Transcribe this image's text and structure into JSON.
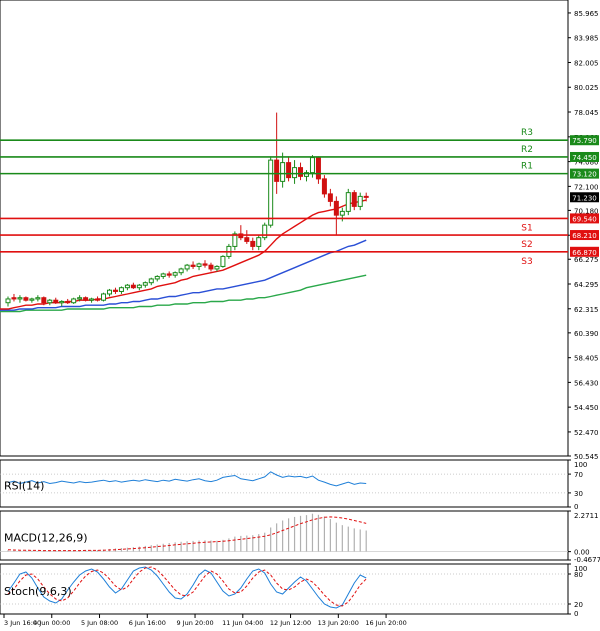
{
  "chart_data": {
    "type": "candlestick",
    "price_axis": {
      "min": 50.545,
      "max": 87.0,
      "ticks": [
        "85.965",
        "83.985",
        "82.005",
        "80.025",
        "78.045",
        "76.060",
        "74.080",
        "72.100",
        "70.180",
        "68.195",
        "66.275",
        "64.295",
        "62.315",
        "60.390",
        "58.405",
        "56.430",
        "54.450",
        "52.470",
        "50.545"
      ]
    },
    "x_ticks": [
      {
        "label": "3 Jun 16:00",
        "i": 0
      },
      {
        "label": "4 Jun 00:00",
        "i": 8
      },
      {
        "label": "5 Jun 08:00",
        "i": 16
      },
      {
        "label": "6 Jun 16:00",
        "i": 24
      },
      {
        "label": "9 Jun 20:00",
        "i": 32
      },
      {
        "label": "11 Jun 04:00",
        "i": 40
      },
      {
        "label": "12 Jun 12:00",
        "i": 48
      },
      {
        "label": "13 Jun 20:00",
        "i": 56
      },
      {
        "label": "16 Jun 20:00",
        "i": 64
      }
    ],
    "levels": [
      {
        "name": "R3",
        "value": 75.79,
        "label": "75.790",
        "color": "#1a8a1a"
      },
      {
        "name": "R2",
        "value": 74.45,
        "label": "74.450",
        "color": "#1a8a1a"
      },
      {
        "name": "R1",
        "value": 73.12,
        "label": "73.120",
        "color": "#1a8a1a"
      },
      {
        "name": "S1",
        "value": 69.54,
        "label": "69.540",
        "color": "#e01010"
      },
      {
        "name": "S2",
        "value": 68.21,
        "label": "68.210",
        "color": "#e01010"
      },
      {
        "name": "S3",
        "value": 66.87,
        "label": "66.870",
        "color": "#e01010"
      }
    ],
    "last_price": {
      "value": 71.23,
      "label": "71.230"
    },
    "candles": [
      [
        62.8,
        63.3,
        62.5,
        63.1
      ],
      [
        63.2,
        63.5,
        62.9,
        63.1
      ],
      [
        63.1,
        63.4,
        62.8,
        63.2
      ],
      [
        63.2,
        63.3,
        62.9,
        63.0
      ],
      [
        63.0,
        63.2,
        62.8,
        63.1
      ],
      [
        63.1,
        63.4,
        62.9,
        63.2
      ],
      [
        63.2,
        63.3,
        62.6,
        62.8
      ],
      [
        62.8,
        63.1,
        62.6,
        63.0
      ],
      [
        63.0,
        63.2,
        62.7,
        62.8
      ],
      [
        62.8,
        63.0,
        62.5,
        62.9
      ],
      [
        62.9,
        63.1,
        62.7,
        62.8
      ],
      [
        62.8,
        63.2,
        62.7,
        63.1
      ],
      [
        63.1,
        63.4,
        62.9,
        63.2
      ],
      [
        63.2,
        63.3,
        62.9,
        63.0
      ],
      [
        63.0,
        63.2,
        62.8,
        63.1
      ],
      [
        63.1,
        63.3,
        62.9,
        63.0
      ],
      [
        63.0,
        63.6,
        62.9,
        63.5
      ],
      [
        63.5,
        63.9,
        63.3,
        63.8
      ],
      [
        63.8,
        64.0,
        63.5,
        63.7
      ],
      [
        63.7,
        64.1,
        63.5,
        64.0
      ],
      [
        64.0,
        64.3,
        63.8,
        64.2
      ],
      [
        64.2,
        64.4,
        63.9,
        64.0
      ],
      [
        64.0,
        64.3,
        63.8,
        64.2
      ],
      [
        64.2,
        64.5,
        64.0,
        64.4
      ],
      [
        64.4,
        64.8,
        64.2,
        64.7
      ],
      [
        64.7,
        65.0,
        64.5,
        64.9
      ],
      [
        64.9,
        65.2,
        64.7,
        65.1
      ],
      [
        65.1,
        65.3,
        64.8,
        65.0
      ],
      [
        65.0,
        65.3,
        64.8,
        65.2
      ],
      [
        65.2,
        65.6,
        65.0,
        65.5
      ],
      [
        65.5,
        65.9,
        65.3,
        65.8
      ],
      [
        65.8,
        66.1,
        65.5,
        65.7
      ],
      [
        65.7,
        66.0,
        65.4,
        65.9
      ],
      [
        65.9,
        66.2,
        65.6,
        65.8
      ],
      [
        65.8,
        66.0,
        65.3,
        65.5
      ],
      [
        65.5,
        65.8,
        65.3,
        65.7
      ],
      [
        65.7,
        66.6,
        65.6,
        66.5
      ],
      [
        66.5,
        67.5,
        66.3,
        67.3
      ],
      [
        67.3,
        68.5,
        67.0,
        68.3
      ],
      [
        68.3,
        69.0,
        67.8,
        68.0
      ],
      [
        68.0,
        68.6,
        67.5,
        67.7
      ],
      [
        67.7,
        68.0,
        67.0,
        67.3
      ],
      [
        67.3,
        68.2,
        67.0,
        68.0
      ],
      [
        68.0,
        69.2,
        67.8,
        69.0
      ],
      [
        69.0,
        74.5,
        68.8,
        74.2
      ],
      [
        74.2,
        78.0,
        71.5,
        72.5
      ],
      [
        72.5,
        74.8,
        72.0,
        74.0
      ],
      [
        74.0,
        74.5,
        72.5,
        72.8
      ],
      [
        72.8,
        74.2,
        72.3,
        73.6
      ],
      [
        73.6,
        74.0,
        72.6,
        72.9
      ],
      [
        72.9,
        73.4,
        72.5,
        73.2
      ],
      [
        73.2,
        74.6,
        72.8,
        74.4
      ],
      [
        74.4,
        74.5,
        72.3,
        72.7
      ],
      [
        72.7,
        73.0,
        71.2,
        71.5
      ],
      [
        71.5,
        71.9,
        70.5,
        70.9
      ],
      [
        70.9,
        71.3,
        68.2,
        69.8
      ],
      [
        69.8,
        70.4,
        69.3,
        70.1
      ],
      [
        70.1,
        71.9,
        69.8,
        71.6
      ],
      [
        71.6,
        71.8,
        70.2,
        70.5
      ],
      [
        70.5,
        71.6,
        70.2,
        71.3
      ],
      [
        71.3,
        71.6,
        70.9,
        71.23
      ]
    ],
    "ma_red": [
      62.3,
      62.4,
      62.5,
      62.6,
      62.6,
      62.7,
      62.7,
      62.8,
      62.8,
      62.8,
      62.9,
      62.9,
      63.0,
      63.0,
      63.0,
      63.1,
      63.1,
      63.2,
      63.3,
      63.4,
      63.5,
      63.6,
      63.7,
      63.8,
      63.9,
      64.1,
      64.2,
      64.3,
      64.4,
      64.6,
      64.7,
      64.9,
      65.0,
      65.1,
      65.2,
      65.3,
      65.4,
      65.6,
      65.8,
      66.0,
      66.2,
      66.4,
      66.6,
      66.9,
      67.4,
      67.9,
      68.3,
      68.6,
      68.9,
      69.2,
      69.5,
      69.8,
      70.0,
      70.1,
      70.2,
      70.3,
      70.5,
      70.7,
      70.8,
      70.9,
      71.0
    ],
    "ma_blue": [
      62.2,
      62.2,
      62.3,
      62.3,
      62.3,
      62.4,
      62.4,
      62.4,
      62.4,
      62.5,
      62.5,
      62.5,
      62.5,
      62.6,
      62.6,
      62.6,
      62.6,
      62.7,
      62.7,
      62.8,
      62.8,
      62.9,
      62.9,
      63.0,
      63.1,
      63.1,
      63.2,
      63.3,
      63.3,
      63.4,
      63.5,
      63.6,
      63.6,
      63.7,
      63.8,
      63.9,
      63.9,
      64.0,
      64.1,
      64.2,
      64.3,
      64.4,
      64.5,
      64.6,
      64.8,
      65.0,
      65.2,
      65.4,
      65.6,
      65.8,
      66.0,
      66.2,
      66.4,
      66.6,
      66.8,
      66.9,
      67.1,
      67.3,
      67.4,
      67.6,
      67.8
    ],
    "ma_green": [
      62.1,
      62.1,
      62.1,
      62.2,
      62.2,
      62.2,
      62.2,
      62.2,
      62.2,
      62.2,
      62.3,
      62.3,
      62.3,
      62.3,
      62.3,
      62.3,
      62.3,
      62.4,
      62.4,
      62.4,
      62.4,
      62.4,
      62.5,
      62.5,
      62.5,
      62.6,
      62.6,
      62.6,
      62.7,
      62.7,
      62.7,
      62.8,
      62.8,
      62.8,
      62.9,
      62.9,
      62.9,
      63.0,
      63.0,
      63.0,
      63.1,
      63.1,
      63.2,
      63.2,
      63.3,
      63.4,
      63.5,
      63.6,
      63.7,
      63.8,
      64.0,
      64.1,
      64.2,
      64.3,
      64.4,
      64.5,
      64.6,
      64.7,
      64.8,
      64.9,
      65.0
    ],
    "panels": [
      {
        "id": "rsi",
        "label": "RSI(14)",
        "ticks": [
          "100",
          "70",
          "30",
          "0"
        ],
        "min": 0,
        "max": 100,
        "levels": [
          70,
          30
        ],
        "series": [
          {
            "color": "#1e7fd8",
            "dash": false,
            "values": [
              52,
              55,
              50,
              53,
              56,
              51,
              54,
              50,
              52,
              55,
              53,
              51,
              54,
              52,
              53,
              55,
              57,
              54,
              56,
              53,
              55,
              57,
              55,
              58,
              56,
              54,
              57,
              55,
              59,
              57,
              55,
              58,
              60,
              56,
              54,
              57,
              63,
              65,
              67,
              60,
              58,
              56,
              60,
              64,
              75,
              68,
              63,
              66,
              64,
              65,
              62,
              66,
              57,
              53,
              48,
              45,
              49,
              53,
              48,
              51,
              50
            ]
          }
        ]
      },
      {
        "id": "macd",
        "label": "MACD(12,26,9)",
        "ticks": [
          "2.2711",
          "0.00",
          "-0.4677"
        ],
        "min": -0.4677,
        "max": 2.2711,
        "histogram": [
          0.08,
          0.06,
          0.05,
          0.06,
          0.05,
          0.04,
          0.05,
          0.04,
          0.05,
          0.04,
          0.05,
          0.06,
          0.07,
          0.08,
          0.07,
          0.09,
          0.12,
          0.15,
          0.18,
          0.2,
          0.22,
          0.25,
          0.28,
          0.32,
          0.36,
          0.4,
          0.44,
          0.48,
          0.52,
          0.55,
          0.58,
          0.6,
          0.62,
          0.63,
          0.62,
          0.61,
          0.66,
          0.74,
          0.84,
          0.88,
          0.9,
          0.92,
          0.98,
          1.06,
          1.35,
          1.58,
          1.74,
          1.86,
          1.94,
          2.0,
          2.04,
          2.12,
          2.06,
          1.96,
          1.82,
          1.62,
          1.48,
          1.4,
          1.3,
          1.24,
          1.18
        ],
        "series": [
          {
            "color": "#e01010",
            "dash": true,
            "values": [
              0.1,
              0.09,
              0.08,
              0.08,
              0.07,
              0.07,
              0.06,
              0.06,
              0.06,
              0.06,
              0.06,
              0.06,
              0.06,
              0.07,
              0.07,
              0.07,
              0.08,
              0.09,
              0.11,
              0.13,
              0.15,
              0.17,
              0.2,
              0.22,
              0.25,
              0.28,
              0.31,
              0.34,
              0.38,
              0.41,
              0.44,
              0.47,
              0.5,
              0.52,
              0.54,
              0.56,
              0.58,
              0.61,
              0.65,
              0.69,
              0.73,
              0.77,
              0.81,
              0.86,
              0.94,
              1.05,
              1.18,
              1.31,
              1.44,
              1.56,
              1.67,
              1.78,
              1.86,
              1.92,
              1.94,
              1.92,
              1.88,
              1.82,
              1.74,
              1.66,
              1.58
            ]
          }
        ]
      },
      {
        "id": "stoch",
        "label": "Stoch(9,6,3)",
        "ticks": [
          "100",
          "80",
          "20",
          "0"
        ],
        "min": 0,
        "max": 100,
        "levels": [
          80,
          20
        ],
        "series": [
          {
            "color": "#1e7fd8",
            "dash": false,
            "values": [
              45,
              62,
              80,
              84,
              72,
              52,
              34,
              26,
              22,
              30,
              48,
              64,
              78,
              86,
              90,
              84,
              70,
              54,
              42,
              50,
              68,
              86,
              92,
              94,
              88,
              76,
              60,
              44,
              32,
              30,
              40,
              58,
              78,
              88,
              82,
              64,
              46,
              36,
              40,
              52,
              70,
              86,
              90,
              82,
              60,
              44,
              40,
              52,
              64,
              74,
              66,
              50,
              34,
              20,
              14,
              12,
              18,
              40,
              62,
              78,
              72
            ]
          },
          {
            "color": "#e01010",
            "dash": true,
            "values": [
              40,
              50,
              66,
              78,
              80,
              70,
              54,
              40,
              30,
              26,
              32,
              46,
              62,
              76,
              85,
              88,
              82,
              70,
              56,
              48,
              54,
              70,
              84,
              92,
              94,
              88,
              76,
              62,
              48,
              38,
              36,
              44,
              60,
              76,
              86,
              80,
              66,
              50,
              42,
              44,
              56,
              72,
              84,
              88,
              78,
              62,
              50,
              48,
              54,
              64,
              70,
              64,
              52,
              38,
              26,
              18,
              16,
              24,
              40,
              58,
              70
            ]
          }
        ]
      }
    ]
  }
}
